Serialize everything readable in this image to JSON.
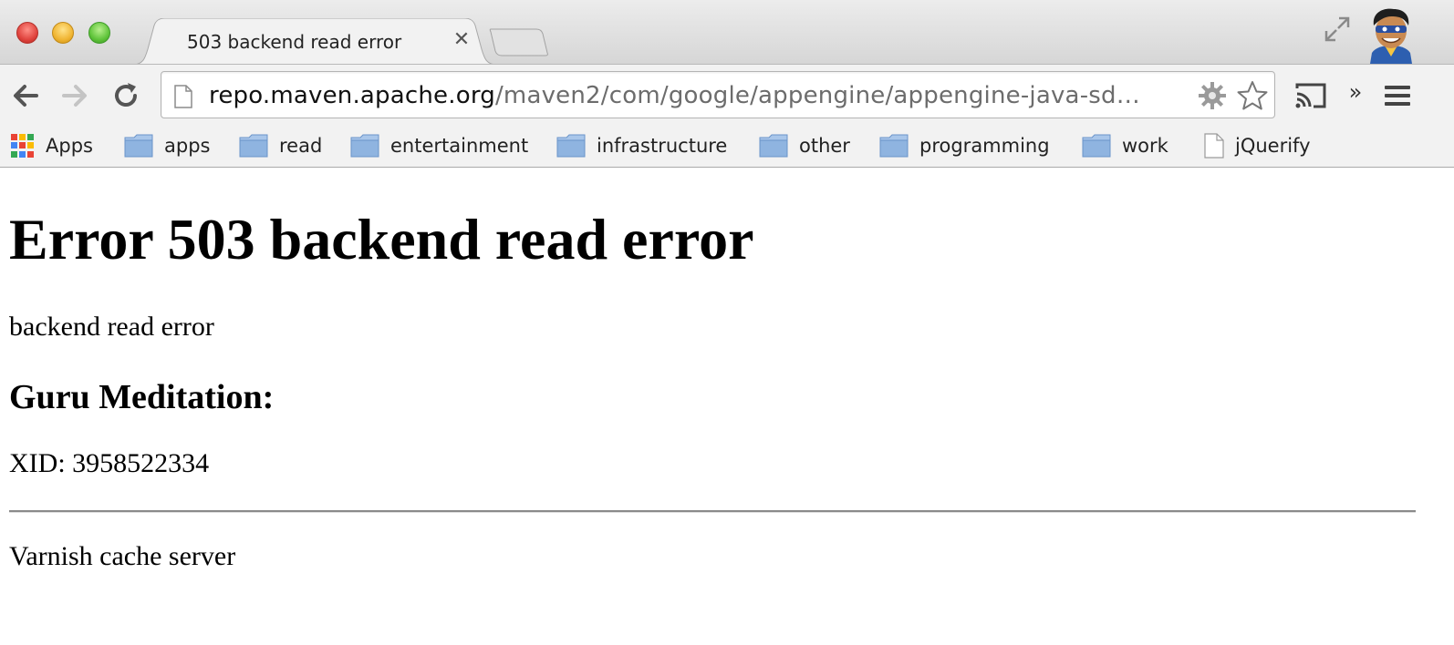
{
  "window": {
    "tab_title": "503 backend read error",
    "tab_close": "✕"
  },
  "toolbar": {
    "url_host": "repo.maven.apache.org",
    "url_path": "/maven2/com/google/appengine/appengine-java-sd…",
    "overflow": "»"
  },
  "bookmarks": [
    {
      "label": "Apps",
      "icon": "apps-grid-icon"
    },
    {
      "label": "apps",
      "icon": "folder-icon"
    },
    {
      "label": "read",
      "icon": "folder-icon"
    },
    {
      "label": "entertainment",
      "icon": "folder-icon"
    },
    {
      "label": "infrastructure",
      "icon": "folder-icon"
    },
    {
      "label": "other",
      "icon": "folder-icon"
    },
    {
      "label": "programming",
      "icon": "folder-icon"
    },
    {
      "label": "work",
      "icon": "folder-icon"
    },
    {
      "label": "jQuerify",
      "icon": "document-icon"
    }
  ],
  "page": {
    "heading": "Error 503 backend read error",
    "message": "backend read error",
    "subheading": "Guru Meditation:",
    "xid": "XID: 3958522334",
    "footer": "Varnish cache server"
  },
  "colors": {
    "folder_blue": "#8fb4e0",
    "url_path_gray": "#6c6c6c"
  }
}
